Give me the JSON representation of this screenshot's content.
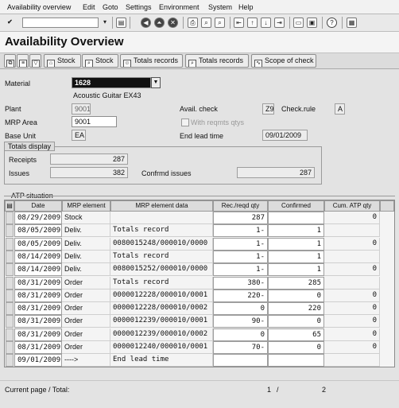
{
  "menu": [
    "Availability overview",
    "Edit",
    "Goto",
    "Settings",
    "Environment",
    "System",
    "Help"
  ],
  "page_title": "Availability Overview",
  "app_toolbar": [
    {
      "label": "Stock",
      "icon": "stock-icon"
    },
    {
      "label": "Stock",
      "icon": "stock-search-icon"
    },
    {
      "label": "Totals records",
      "icon": "person-icon"
    },
    {
      "label": "Totals records",
      "icon": "person-search-icon"
    },
    {
      "label": "Scope of check",
      "icon": "scope-icon"
    }
  ],
  "header": {
    "material_label": "Material",
    "material_value": "1628",
    "material_desc": "Acoustic Guitar EX43",
    "plant_label": "Plant",
    "plant_value": "9001",
    "mrp_area_label": "MRP Area",
    "mrp_area_value": "9001",
    "base_unit_label": "Base Unit",
    "base_unit_value": "EA",
    "avail_check_label": "Avail. check",
    "avail_check_value": "Z9",
    "check_rule_label": "Check.rule",
    "check_rule_value": "A",
    "with_reqmts_label": "With reqmts qtys",
    "end_lead_label": "End lead time",
    "end_lead_value": "09/01/2009"
  },
  "totals": {
    "group_title": "Totals display",
    "receipts_label": "Receipts",
    "receipts_value": "287",
    "issues_label": "Issues",
    "issues_value": "382",
    "confirmed_label": "Confrmd issues",
    "confirmed_value": "287"
  },
  "atp": {
    "group_title": "ATP situation",
    "columns": [
      "Date",
      "MRP element",
      "MRP element data",
      "Rec./reqd qty",
      "Confirmed",
      "Cum. ATP qty"
    ],
    "rows": [
      [
        "08/29/2009",
        "Stock",
        "",
        "287",
        "",
        "0"
      ],
      [
        "08/05/2009",
        "Deliv.",
        "Totals record",
        "1-",
        "1",
        ""
      ],
      [
        "08/05/2009",
        "Deliv.",
        "0080015248/000010/0000",
        "1-",
        "1",
        "0"
      ],
      [
        "08/14/2009",
        "Deliv.",
        "Totals record",
        "1-",
        "1",
        ""
      ],
      [
        "08/14/2009",
        "Deliv.",
        "0080015252/000010/0000",
        "1-",
        "1",
        "0"
      ],
      [
        "08/31/2009",
        "Order",
        "Totals record",
        "380-",
        "285",
        ""
      ],
      [
        "08/31/2009",
        "Order",
        "0000012228/000010/0001",
        "220-",
        "0",
        "0"
      ],
      [
        "08/31/2009",
        "Order",
        "0000012228/000010/0002",
        "0",
        "220",
        "0"
      ],
      [
        "08/31/2009",
        "Order",
        "0000012239/000010/0001",
        "90-",
        "0",
        "0"
      ],
      [
        "08/31/2009",
        "Order",
        "0000012239/000010/0002",
        "0",
        "65",
        "0"
      ],
      [
        "08/31/2009",
        "Order",
        "0000012240/000010/0001",
        "70-",
        "0",
        "0"
      ],
      [
        "09/01/2009",
        "---->",
        "End lead time",
        "",
        "",
        ""
      ]
    ]
  },
  "footer": {
    "page_label": "Current page / Total:",
    "current_page": "1",
    "slash": "/",
    "total_pages": "2"
  }
}
